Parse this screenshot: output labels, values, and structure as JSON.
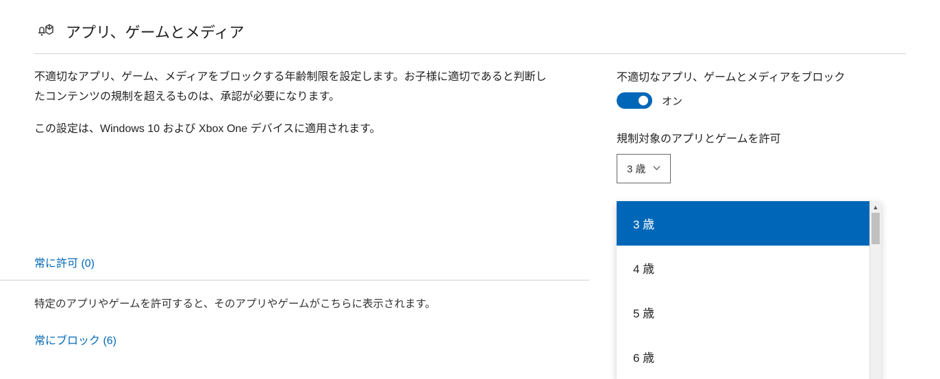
{
  "header": {
    "title": "アプリ、ゲームとメディア"
  },
  "main": {
    "desc1": "不適切なアプリ、ゲーム、メディアをブロックする年齢制限を設定します。お子様に適切であると判断したコンテンツの規制を超えるものは、承認が必要になります。",
    "desc2": "この設定は、Windows 10 および Xbox One デバイスに適用されます。",
    "always_allow_link": "常に許可 (0)",
    "allow_note": "特定のアプリやゲームを許可すると、そのアプリやゲームがこちらに表示されます。",
    "always_block_link": "常にブロック (6)"
  },
  "side": {
    "block_label": "不適切なアプリ、ゲームとメディアをブロック",
    "toggle_state": "オン",
    "allow_label": "規制対象のアプリとゲームを許可",
    "selected": "3 歳",
    "options": [
      "3 歳",
      "4 歳",
      "5 歳",
      "6 歳"
    ]
  }
}
